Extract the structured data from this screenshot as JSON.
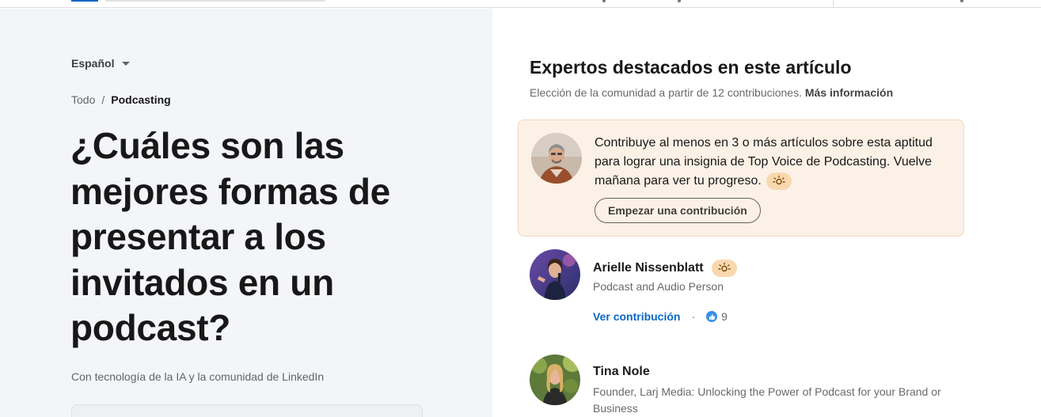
{
  "language": {
    "selected": "Español"
  },
  "breadcrumb": {
    "root": "Todo",
    "separator": "/",
    "current": "Podcasting"
  },
  "article": {
    "title": "¿Cuáles son las mejores formas de presentar a los invitados en un podcast?",
    "powered_by": "Con tecnología de la IA y la comunidad de LinkedIn"
  },
  "experts": {
    "heading": "Expertos destacados en este artículo",
    "subheading": "Elección de la comunidad a partir de 12 contribuciones.",
    "more_info": "Más información",
    "promo": {
      "text": "Contribuye al menos en 3 o más artículos sobre esta aptitud para lograr una insignia de Top Voice de Podcasting. Vuelve mañana para ver tu progreso.",
      "button": "Empezar una contribución",
      "badge_icon": "top-voice-badge-icon"
    },
    "list": [
      {
        "name": "Arielle Nissenblatt",
        "role": "Podcast and Audio Person",
        "link": "Ver contribución",
        "reactions": "9",
        "has_badge": true
      },
      {
        "name": "Tina Nole",
        "role": "Founder, Larj Media: Unlocking the Power of Podcast for your Brand or Business",
        "has_badge": false
      }
    ]
  },
  "colors": {
    "link": "#0a66c2",
    "left_bg": "#f3f5f8",
    "promo_bg": "#fcf1e6",
    "badge_bg": "#f8d8ae"
  }
}
